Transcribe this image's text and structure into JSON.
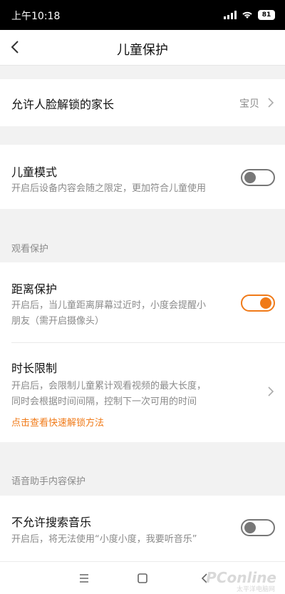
{
  "status_bar": {
    "time": "上午10:18",
    "battery": "81"
  },
  "header": {
    "title": "儿童保护"
  },
  "face_unlock": {
    "label": "允许人脸解锁的家长",
    "value": "宝贝"
  },
  "child_mode": {
    "title": "儿童模式",
    "desc": "开启后设备内容会随之限定，更加符合儿童使用",
    "enabled": false
  },
  "viewing_group": {
    "label": "观看保护"
  },
  "distance": {
    "title": "距离保护",
    "desc_line1": "开启后，当儿童距离屏幕过近时，小度会提醒小",
    "desc_line2": "朋友（需开启摄像头）",
    "enabled": true
  },
  "time_limit": {
    "title": "时长限制",
    "desc_line1": "开启后，会限制儿童累计观看视频的最大长度，",
    "desc_line2": "同时会根据时间间隔，控制下一次可用的时间",
    "link": "点击查看快速解锁方法"
  },
  "voice_group": {
    "label": "语音助手内容保护"
  },
  "music": {
    "title": "不允许搜索音乐",
    "desc": "开启后，将无法使用“小度小度，我要听音乐”",
    "enabled": false
  },
  "nav": {
    "watermark": "PConline",
    "watermark_sub": "太平洋电脑网"
  },
  "colors": {
    "accent": "#f07a18",
    "toggle_off": "#777777"
  }
}
